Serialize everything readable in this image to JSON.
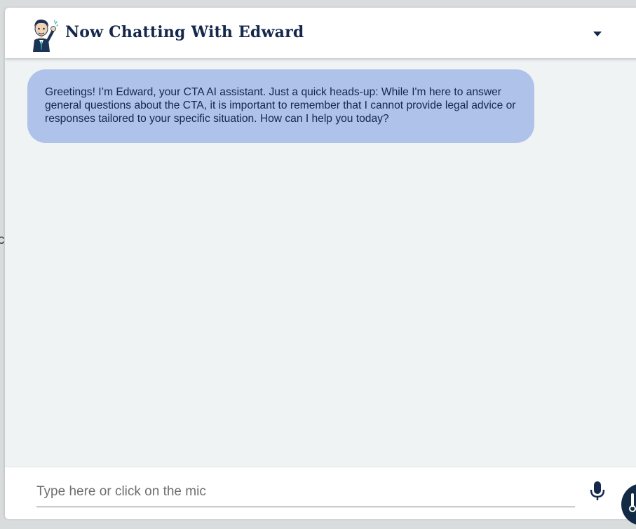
{
  "backdrop": {
    "edge_text": "c"
  },
  "header": {
    "title": "Now Chatting With Edward",
    "avatar_icon": "edward-waving-avatar-icon",
    "menu_icon": "caret-down-icon"
  },
  "messages": [
    {
      "sender": "Edward",
      "text": "Greetings! I’m Edward, your CTA AI assistant. Just a quick heads-up: While I'm here to answer general questions about the CTA, it is important to remember that I cannot provide legal advice or responses tailored to your specific situation. How can I help you today?"
    }
  ],
  "composer": {
    "placeholder": "Type here or click on the mic",
    "value": "",
    "mic_icon": "microphone-icon"
  },
  "fab": {
    "icon": "thermometer-icon"
  },
  "colors": {
    "accent_dark": "#14284b",
    "bubble_bg": "#aec2ea",
    "chat_bg": "#f0f3f4",
    "fab_bg": "#132a44"
  }
}
